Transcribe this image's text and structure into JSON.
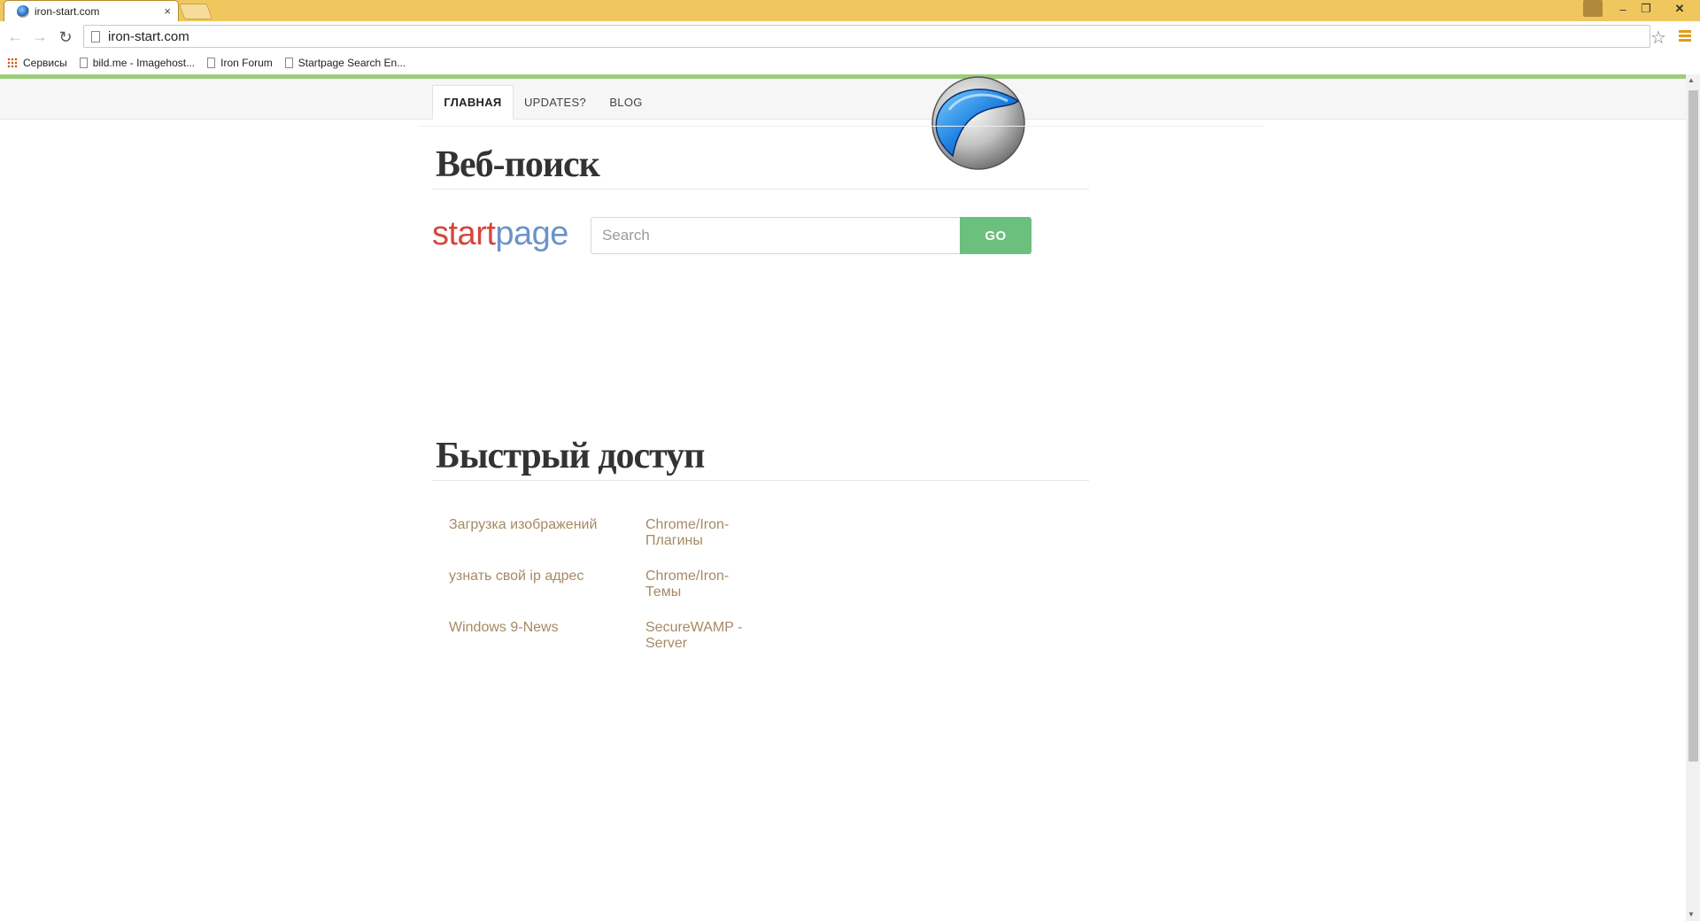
{
  "browser": {
    "tab_title": "iron-start.com",
    "tab_close": "×",
    "url": "iron-start.com",
    "window_controls": {
      "minimize": "–",
      "maximize": "❐",
      "close": "✕"
    },
    "nav_icons": {
      "back": "arrow-left-icon",
      "forward": "arrow-right-icon",
      "reload": "reload-icon"
    },
    "nav_glyphs": {
      "back": "←",
      "forward": "→",
      "reload": "↻"
    },
    "star_glyph": "☆",
    "bookmarks": [
      {
        "label": "Сервисы",
        "icon": "apps-grid-icon"
      },
      {
        "label": "bild.me - Imagehost...",
        "icon": "page-icon"
      },
      {
        "label": "Iron Forum",
        "icon": "page-icon"
      },
      {
        "label": "Startpage Search En...",
        "icon": "page-icon"
      }
    ],
    "accent_color": "#f0c65e"
  },
  "site_nav": {
    "items": [
      {
        "label": "ГЛАВНАЯ",
        "active": true
      },
      {
        "label": "UPDATES?",
        "active": false
      },
      {
        "label": "BLOG",
        "active": false
      }
    ]
  },
  "web_search": {
    "title": "Веб-поиск",
    "logo_start": "start",
    "logo_page": "page",
    "placeholder": "Search",
    "value": "",
    "go_label": "GO",
    "go_color": "#6cc07d"
  },
  "quick_access": {
    "title": "Быстрый доступ",
    "links": [
      "Загрузка изображений",
      "узнать свой ip адрес",
      "Windows 9-News",
      "Chrome/Iron-Плагины",
      "Chrome/Iron-Темы",
      "SecureWAMP - Server"
    ],
    "link_color": "#a58a64"
  }
}
